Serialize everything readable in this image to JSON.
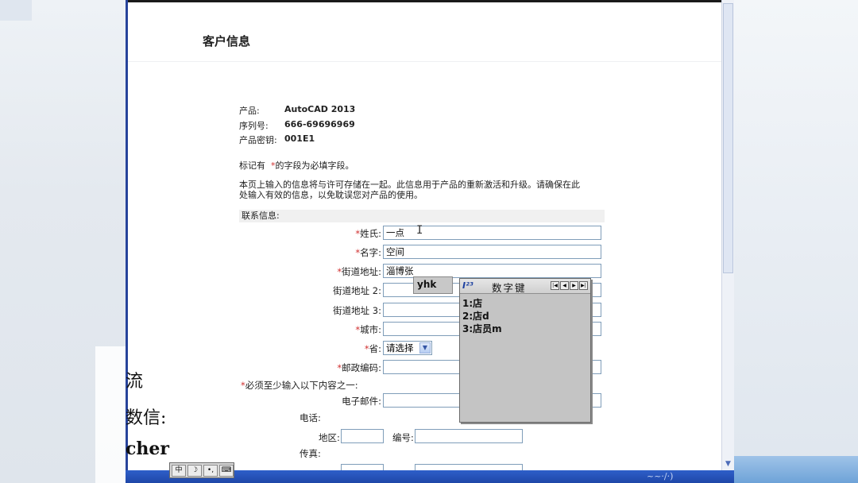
{
  "page": {
    "title": "客户信息"
  },
  "product": {
    "product_label": "产品:",
    "product_value": "AutoCAD 2013",
    "serial_label": "序列号:",
    "serial_value": "666-69696969",
    "key_label": "产品密钥:",
    "key_value": "001E1"
  },
  "notes": {
    "required_pre": "标记有",
    "required_star": "*",
    "required_post": "的字段为必填字段。",
    "info_line1": "本页上输入的信息将与许可存储在一起。此信息用于产品的重新激活和升级。请确保在此",
    "info_line2": "处输入有效的信息，以免耽误您对产品的使用。"
  },
  "contact": {
    "section_title": "联系信息:",
    "star": "*",
    "last_name_label": "姓氏:",
    "last_name_value": "一点",
    "first_name_label": "名字:",
    "first_name_value": "空间",
    "street1_label": "街道地址:",
    "street1_value": "淄博张",
    "street2_label": "街道地址  2:",
    "street3_label": "街道地址  3:",
    "city_label": "城市:",
    "province_label": "省:",
    "province_selected": "请选择",
    "zip_label": "邮政编码:",
    "at_least_one": "必须至少输入以下内容之一:",
    "email_label": "电子邮件:",
    "phone_label": "电话:",
    "area_label": "地区:",
    "number_label": "编号:",
    "fax_label": "传真:"
  },
  "ime": {
    "composition": "yhk",
    "logo": "I²³",
    "title": "数字键",
    "candidates": [
      "1:店",
      "2:店d",
      "3:店员m"
    ],
    "toolbar": [
      "中",
      "☽",
      "•,",
      "⌨"
    ]
  },
  "overlay": {
    "line1": "流",
    "line2": "数信:",
    "line3": "cher"
  }
}
